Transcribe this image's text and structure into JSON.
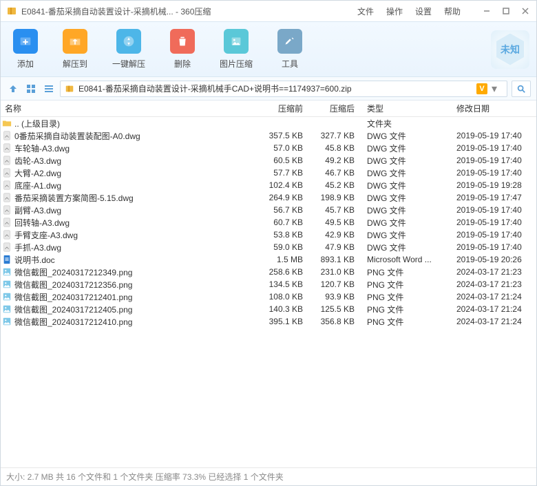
{
  "titlebar": {
    "title": "E0841-番茄采摘自动装置设计-采摘机械... - 360压缩",
    "menu": [
      "文件",
      "操作",
      "设置",
      "帮助"
    ]
  },
  "toolbar": {
    "add": "添加",
    "extract_to": "解压到",
    "one_click": "一键解压",
    "delete": "删除",
    "image_compress": "图片压缩",
    "tools": "工具",
    "badge": "未知"
  },
  "pathbar": {
    "text": "E0841-番茄采摘自动装置设计-采摘机械手CAD+说明书==1174937=600.zip",
    "vbadge": "V"
  },
  "columns": {
    "name": "名称",
    "before": "压缩前",
    "after": "压缩后",
    "type": "类型",
    "date": "修改日期"
  },
  "rows": [
    {
      "icon": "folder",
      "name": ".. (上级目录)",
      "before": "",
      "after": "",
      "type": "文件夹",
      "date": ""
    },
    {
      "icon": "dwg",
      "name": "0番茄采摘自动装置装配图-A0.dwg",
      "before": "357.5 KB",
      "after": "327.7 KB",
      "type": "DWG 文件",
      "date": "2019-05-19 17:40"
    },
    {
      "icon": "dwg",
      "name": "车轮轴-A3.dwg",
      "before": "57.0 KB",
      "after": "45.8 KB",
      "type": "DWG 文件",
      "date": "2019-05-19 17:40"
    },
    {
      "icon": "dwg",
      "name": "齿轮-A3.dwg",
      "before": "60.5 KB",
      "after": "49.2 KB",
      "type": "DWG 文件",
      "date": "2019-05-19 17:40"
    },
    {
      "icon": "dwg",
      "name": "大臂-A2.dwg",
      "before": "57.7 KB",
      "after": "46.7 KB",
      "type": "DWG 文件",
      "date": "2019-05-19 17:40"
    },
    {
      "icon": "dwg",
      "name": "底座-A1.dwg",
      "before": "102.4 KB",
      "after": "45.2 KB",
      "type": "DWG 文件",
      "date": "2019-05-19 19:28"
    },
    {
      "icon": "dwg",
      "name": "番茄采摘装置方案简图-5.15.dwg",
      "before": "264.9 KB",
      "after": "198.9 KB",
      "type": "DWG 文件",
      "date": "2019-05-19 17:47"
    },
    {
      "icon": "dwg",
      "name": "副臂-A3.dwg",
      "before": "56.7 KB",
      "after": "45.7 KB",
      "type": "DWG 文件",
      "date": "2019-05-19 17:40"
    },
    {
      "icon": "dwg",
      "name": "回转轴-A3.dwg",
      "before": "60.7 KB",
      "after": "49.5 KB",
      "type": "DWG 文件",
      "date": "2019-05-19 17:40"
    },
    {
      "icon": "dwg",
      "name": "手臂支座-A3.dwg",
      "before": "53.8 KB",
      "after": "42.9 KB",
      "type": "DWG 文件",
      "date": "2019-05-19 17:40"
    },
    {
      "icon": "dwg",
      "name": "手抓-A3.dwg",
      "before": "59.0 KB",
      "after": "47.9 KB",
      "type": "DWG 文件",
      "date": "2019-05-19 17:40"
    },
    {
      "icon": "doc",
      "name": "说明书.doc",
      "before": "1.5 MB",
      "after": "893.1 KB",
      "type": "Microsoft Word ...",
      "date": "2019-05-19 20:26"
    },
    {
      "icon": "png",
      "name": "微信截图_20240317212349.png",
      "before": "258.6 KB",
      "after": "231.0 KB",
      "type": "PNG 文件",
      "date": "2024-03-17 21:23"
    },
    {
      "icon": "png",
      "name": "微信截图_20240317212356.png",
      "before": "134.5 KB",
      "after": "120.7 KB",
      "type": "PNG 文件",
      "date": "2024-03-17 21:23"
    },
    {
      "icon": "png",
      "name": "微信截图_20240317212401.png",
      "before": "108.0 KB",
      "after": "93.9 KB",
      "type": "PNG 文件",
      "date": "2024-03-17 21:24"
    },
    {
      "icon": "png",
      "name": "微信截图_20240317212405.png",
      "before": "140.3 KB",
      "after": "125.5 KB",
      "type": "PNG 文件",
      "date": "2024-03-17 21:24"
    },
    {
      "icon": "png",
      "name": "微信截图_20240317212410.png",
      "before": "395.1 KB",
      "after": "356.8 KB",
      "type": "PNG 文件",
      "date": "2024-03-17 21:24"
    }
  ],
  "status": "大小: 2.7 MB 共 16 个文件和 1 个文件夹 压缩率 73.3% 已经选择 1 个文件夹"
}
